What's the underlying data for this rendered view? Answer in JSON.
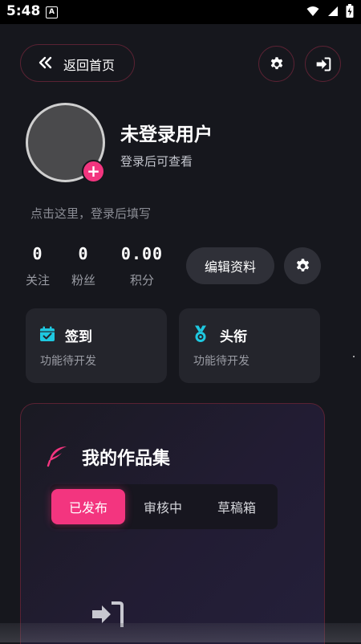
{
  "status_bar": {
    "time": "5:48",
    "notification_icon": "A"
  },
  "header": {
    "back_label": "返回首页"
  },
  "profile": {
    "username": "未登录用户",
    "subtitle": "登录后可查看",
    "bio_placeholder": "点击这里，登录后填写",
    "avatar_add": "+"
  },
  "stats": [
    {
      "value": "0",
      "label": "关注"
    },
    {
      "value": "0",
      "label": "粉丝"
    },
    {
      "value": "0.00",
      "label": "积分"
    }
  ],
  "actions": {
    "edit_profile": "编辑资料"
  },
  "cards": [
    {
      "title": "签到",
      "desc": "功能待开发",
      "icon": "calendar-check-icon"
    },
    {
      "title": "头衔",
      "desc": "功能待开发",
      "icon": "medal-icon"
    }
  ],
  "portfolio": {
    "title": "我的作品集",
    "tabs": [
      {
        "label": "已发布",
        "active": true
      },
      {
        "label": "审核中",
        "active": false
      },
      {
        "label": "草稿箱",
        "active": false
      }
    ]
  },
  "colors": {
    "accent": "#f3357f",
    "card_icon": "#1ec8e0",
    "background": "#16171d"
  }
}
